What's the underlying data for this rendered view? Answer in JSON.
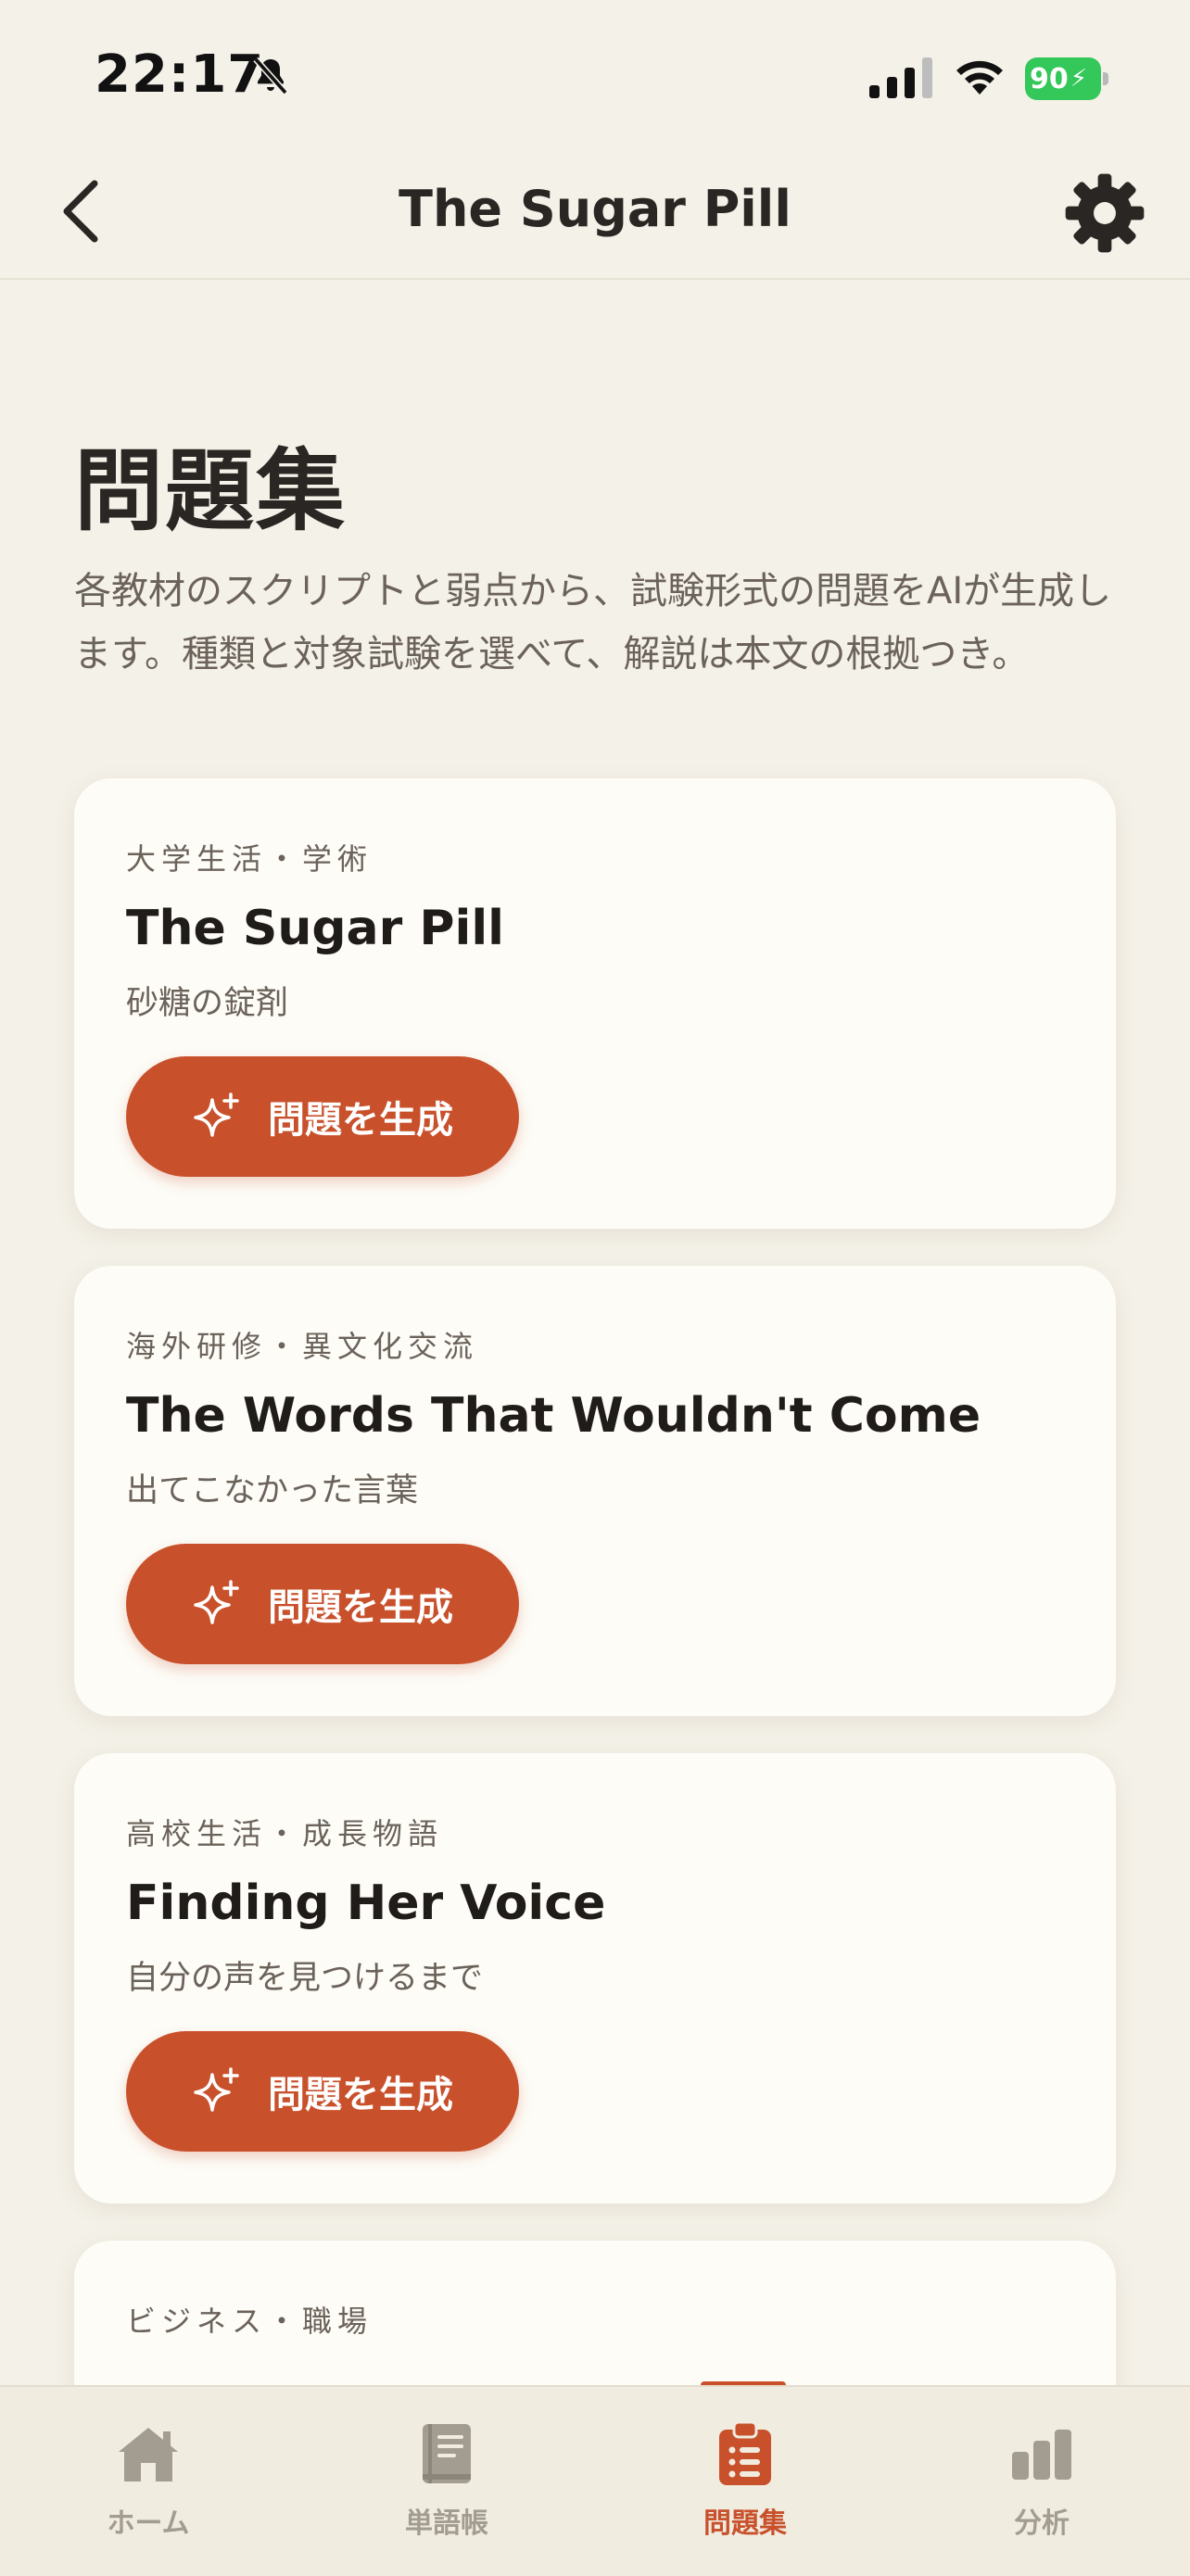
{
  "status_bar": {
    "time": "22:17",
    "battery": "90"
  },
  "nav": {
    "title": "The Sugar Pill",
    "back_icon": "chevron-left-icon",
    "settings_icon": "gear-icon"
  },
  "page": {
    "title": "問題集",
    "description": "各教材のスクリプトと弱点から、試験形式の問題をAIが生成します。種類と対象試験を選べて、解説は本文の根拠つき。"
  },
  "cards": [
    {
      "category": "大学生活・学術",
      "title": "The Sugar Pill",
      "subtitle": "砂糖の錠剤",
      "button": "問題を生成"
    },
    {
      "category": "海外研修・異文化交流",
      "title": "The Words That Wouldn't Come",
      "subtitle": "出てこなかった言葉",
      "button": "問題を生成"
    },
    {
      "category": "高校生活・成長物語",
      "title": "Finding Her Voice",
      "subtitle": "自分の声を見つけるまで",
      "button": "問題を生成"
    },
    {
      "category": "ビジネス・職場"
    }
  ],
  "tabs": [
    {
      "label": "ホーム",
      "icon": "home-icon",
      "active": false
    },
    {
      "label": "単語帳",
      "icon": "book-icon",
      "active": false
    },
    {
      "label": "問題集",
      "icon": "clipboard-list-icon",
      "active": true
    },
    {
      "label": "分析",
      "icon": "bar-chart-icon",
      "active": false
    }
  ],
  "colors": {
    "accent": "#c8512c",
    "background": "#f4f1e8",
    "card": "#fdfcf7",
    "battery": "#34c759"
  }
}
